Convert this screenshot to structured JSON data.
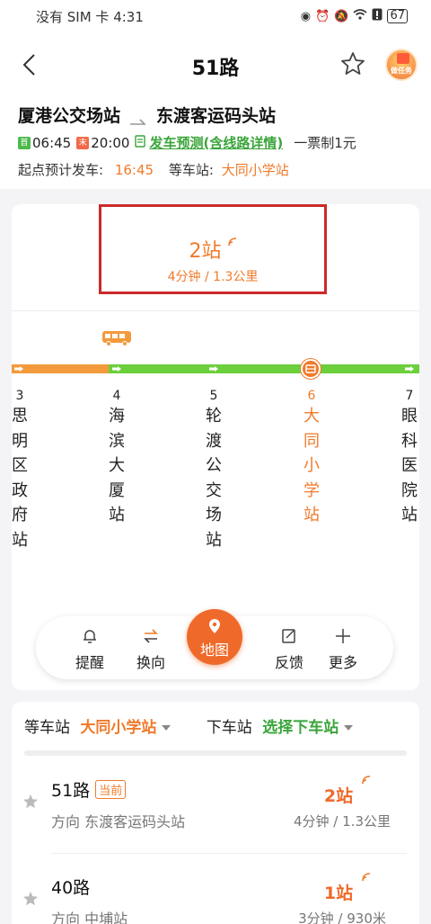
{
  "status_bar": {
    "text": "没有 SIM 卡 4:31",
    "battery": "67"
  },
  "header": {
    "title": "51路",
    "task_label": "做任务"
  },
  "route": {
    "from": "厦港公交场站",
    "to": "东渡客运码头站",
    "first_tag": "首",
    "first_time": "06:45",
    "last_tag": "末",
    "last_time": "20:00",
    "predict_link": "发车预测(含线路详情)",
    "ticket": "一票制1元",
    "depart_label": "起点预计发车:",
    "depart_time": "16:45",
    "wait_label": "等车站:",
    "wait_station": "大同小学站"
  },
  "arrival": {
    "stops": "2站",
    "eta": "4分钟 / 1.3公里"
  },
  "stops": [
    {
      "num": "3",
      "name": "思明区政府站",
      "active": false
    },
    {
      "num": "4",
      "name": "海滨大厦站",
      "active": false
    },
    {
      "num": "5",
      "name": "轮渡公交场站",
      "active": false
    },
    {
      "num": "6",
      "name": "大同小学站",
      "active": true
    },
    {
      "num": "7",
      "name": "眼科医院站",
      "active": false
    }
  ],
  "toolbar": {
    "remind": "提醒",
    "switch": "换向",
    "map": "地图",
    "feedback": "反馈",
    "more": "更多"
  },
  "filters": {
    "wait_label": "等车站",
    "wait_value": "大同小学站",
    "alight_label": "下车站",
    "alight_value": "选择下车站"
  },
  "routes_list": [
    {
      "name": "51路",
      "badge": "当前",
      "direction": "方向 东渡客运码头站",
      "stops": "2站",
      "dist": "4分钟 / 1.3公里"
    },
    {
      "name": "40路",
      "badge": "",
      "direction": "方向 中埔站",
      "stops": "1站",
      "dist": "3分钟 / 930米"
    }
  ],
  "colors": {
    "accent": "#ef7a2a",
    "green": "#6ccf3c",
    "highlight_box": "#cc2a2a"
  }
}
